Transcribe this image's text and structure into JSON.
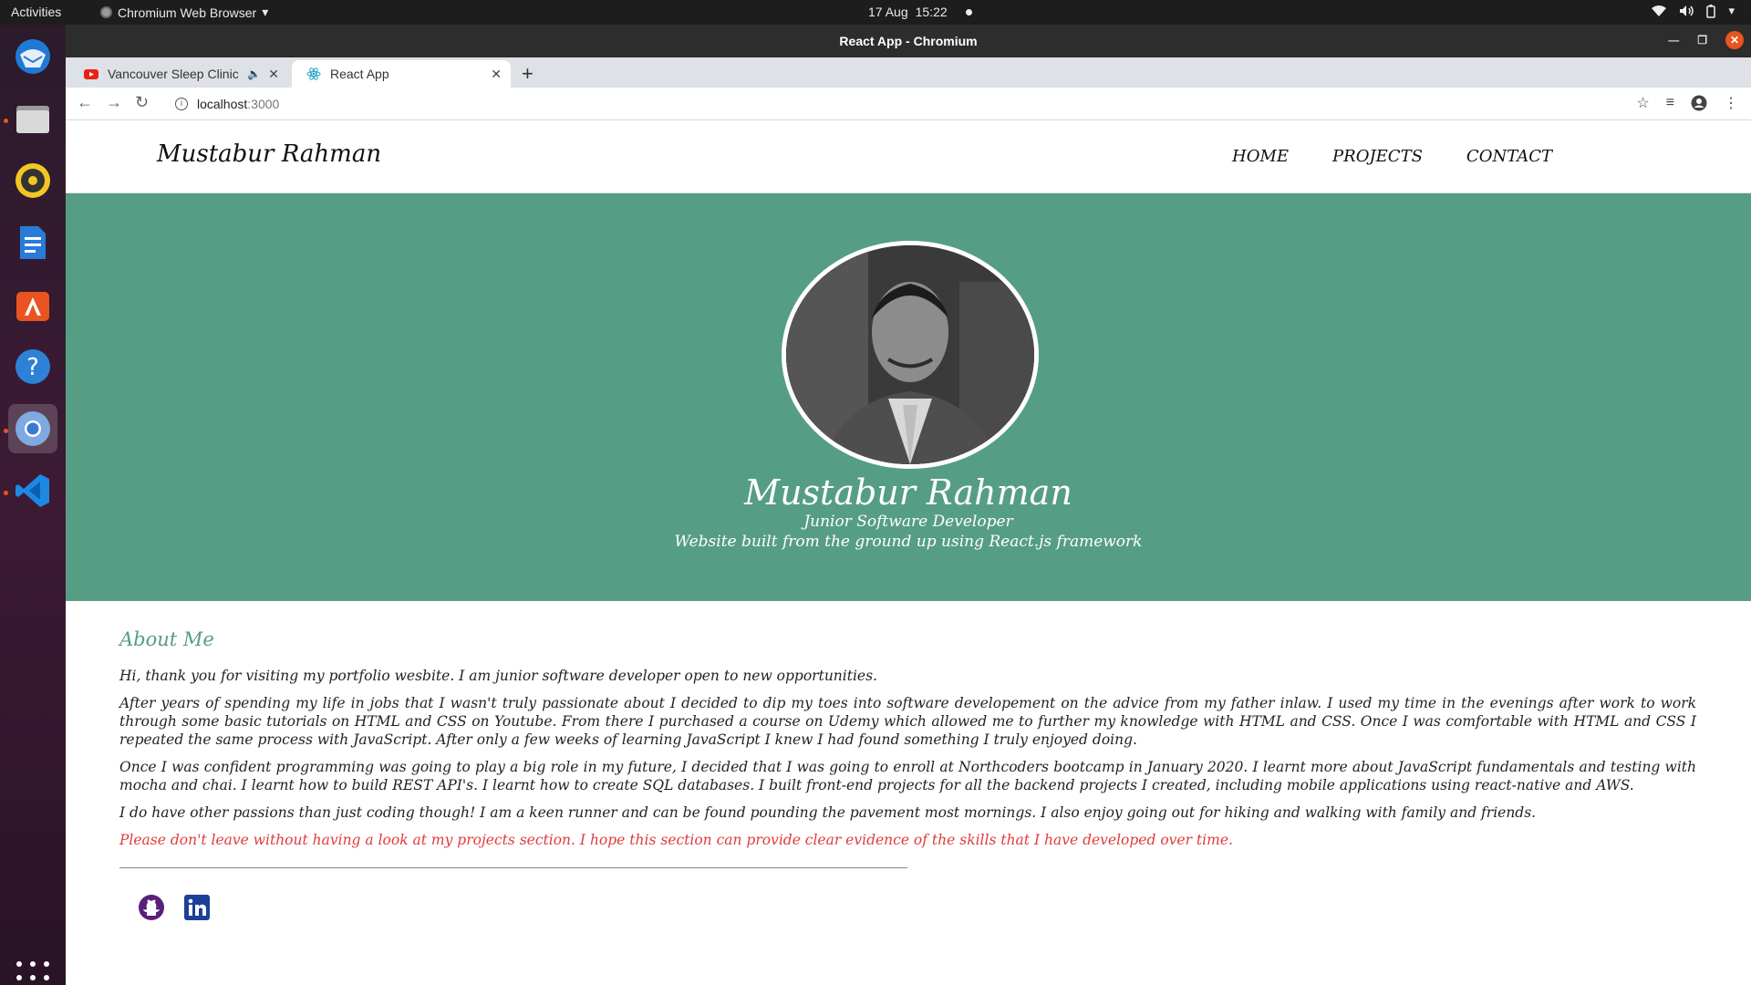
{
  "os": {
    "activities": "Activities",
    "app_menu": "Chromium Web Browser",
    "date": "17 Aug",
    "time": "15:22"
  },
  "window": {
    "title": "React App - Chromium"
  },
  "tabs": [
    {
      "label": "Vancouver Sleep Clinic",
      "favicon": "youtube-icon",
      "audible": true
    },
    {
      "label": "React App",
      "favicon": "react-icon",
      "active": true
    }
  ],
  "toolbar": {
    "url_host": "localhost",
    "url_port": ":3000"
  },
  "site": {
    "brand": "Mustabur Rahman",
    "nav": [
      "HOME",
      "PROJECTS",
      "CONTACT"
    ],
    "hero": {
      "name": "Mustabur Rahman",
      "role": "Junior Software Developer",
      "description": "Website built from the ground up using React.js framework"
    },
    "about": {
      "heading": "About Me",
      "paragraphs": [
        "Hi, thank you for visiting my portfolio wesbite. I am junior software developer open to new opportunities.",
        "After years of spending my life in jobs that I wasn't truly passionate about I decided to dip my toes into software developement on the advice from my father inlaw. I used my time in the evenings after work to work through some basic tutorials on HTML and CSS on Youtube. From there I purchased a course on Udemy which allowed me to further my knowledge with HTML and CSS. Once I was comfortable with HTML and CSS I repeated the same process with JavaScript. After only a few weeks of learning JavaScript I knew I had found something I truly enjoyed doing.",
        "Once I was confident programming was going to play a big role in my future, I decided that I was going to enroll at Northcoders bootcamp in January 2020. I learnt more about JavaScript fundamentals and testing with mocha and chai. I learnt how to build REST API's. I learnt how to create SQL databases. I built front-end projects for all the backend projects I created, including mobile applications using react-native and AWS.",
        "I do have other passions than just coding though! I am a keen runner and can be found pounding the pavement most mornings. I also enjoy going out for hiking and walking with family and friends."
      ],
      "note": "Please don't leave without having a look at my projects section. I hope this section can provide clear evidence of the skills that I have developed over time."
    },
    "socials": [
      "github-icon",
      "linkedin-icon"
    ]
  },
  "colors": {
    "hero_bg": "#569d86",
    "accent": "#569d86",
    "note": "#e23a3a",
    "github": "#5a1f7a",
    "linkedin": "#1c3f9a"
  }
}
